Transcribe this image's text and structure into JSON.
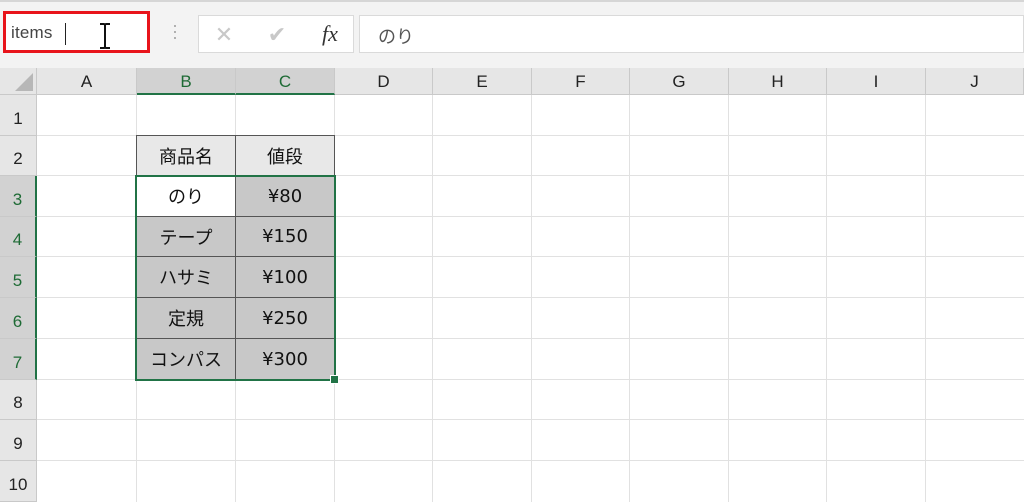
{
  "name_box": {
    "value": "items"
  },
  "formula_bar": {
    "cancel_glyph": "✕",
    "enter_glyph": "✔",
    "fx_label": "fx",
    "content": "のり"
  },
  "columns": [
    "A",
    "B",
    "C",
    "D",
    "E",
    "F",
    "G",
    "H",
    "I",
    "J"
  ],
  "selected_columns": [
    "B",
    "C"
  ],
  "rows": [
    "1",
    "2",
    "3",
    "4",
    "5",
    "6",
    "7",
    "8",
    "9",
    "10"
  ],
  "selected_rows": [
    "3",
    "4",
    "5",
    "6",
    "7"
  ],
  "table": {
    "headers": [
      "商品名",
      "値段"
    ],
    "rows": [
      [
        "のり",
        "¥80"
      ],
      [
        "テープ",
        "¥150"
      ],
      [
        "ハサミ",
        "¥100"
      ],
      [
        "定規",
        "¥250"
      ],
      [
        "コンパス",
        "¥300"
      ]
    ]
  },
  "colors": {
    "selection": "#217346",
    "name_box_highlight": "#e8141b",
    "selected_fill": "#c8c8c8"
  },
  "icons": {
    "name_box_cursor": "i-beam-cursor-icon",
    "formula_menu": "more-vertical-icon"
  }
}
